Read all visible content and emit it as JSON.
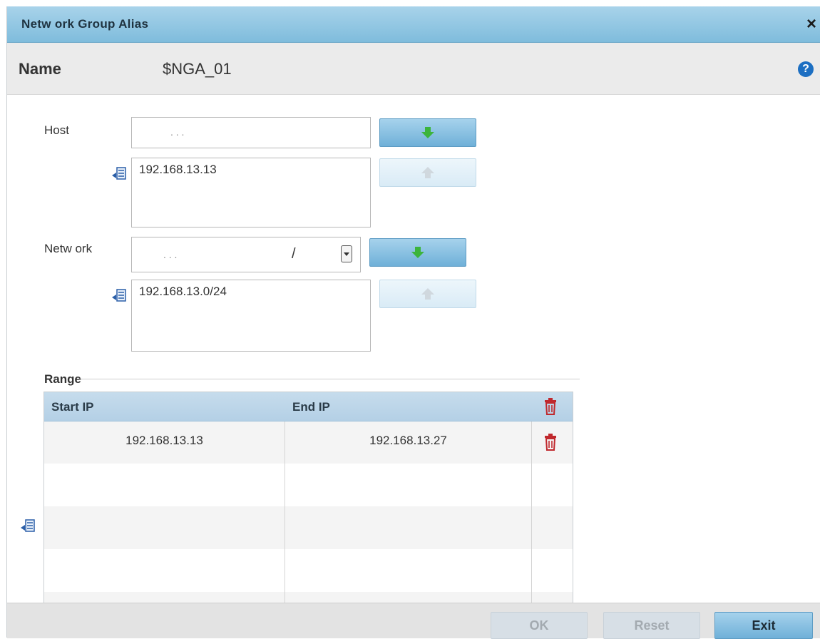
{
  "dialog": {
    "title": "Netw ork Group Alias",
    "close_label": "×",
    "name_label": "Name",
    "name_value": "$NGA_01",
    "help_label": "?"
  },
  "host": {
    "label": "Host",
    "ip_dots": ".   .   .",
    "entries": [
      "192.168.13.13"
    ]
  },
  "network": {
    "label": "Netw ork",
    "ip_dots": ".   .   .",
    "slash": "/",
    "entries": [
      "192.168.13.0/24"
    ]
  },
  "range": {
    "label": "Range",
    "columns": [
      "Start IP",
      "End IP"
    ],
    "rows": [
      {
        "start": "192.168.13.13",
        "end": "192.168.13.27"
      }
    ]
  },
  "footer": {
    "ok_label": "OK",
    "reset_label": "Reset",
    "exit_label": "Exit"
  },
  "colors": {
    "titlebar": "#8fc6e3",
    "accent_button": "#6fb0d8",
    "add_arrow": "#3cb43c",
    "trash": "#c0282d",
    "help": "#1d6fc2"
  }
}
